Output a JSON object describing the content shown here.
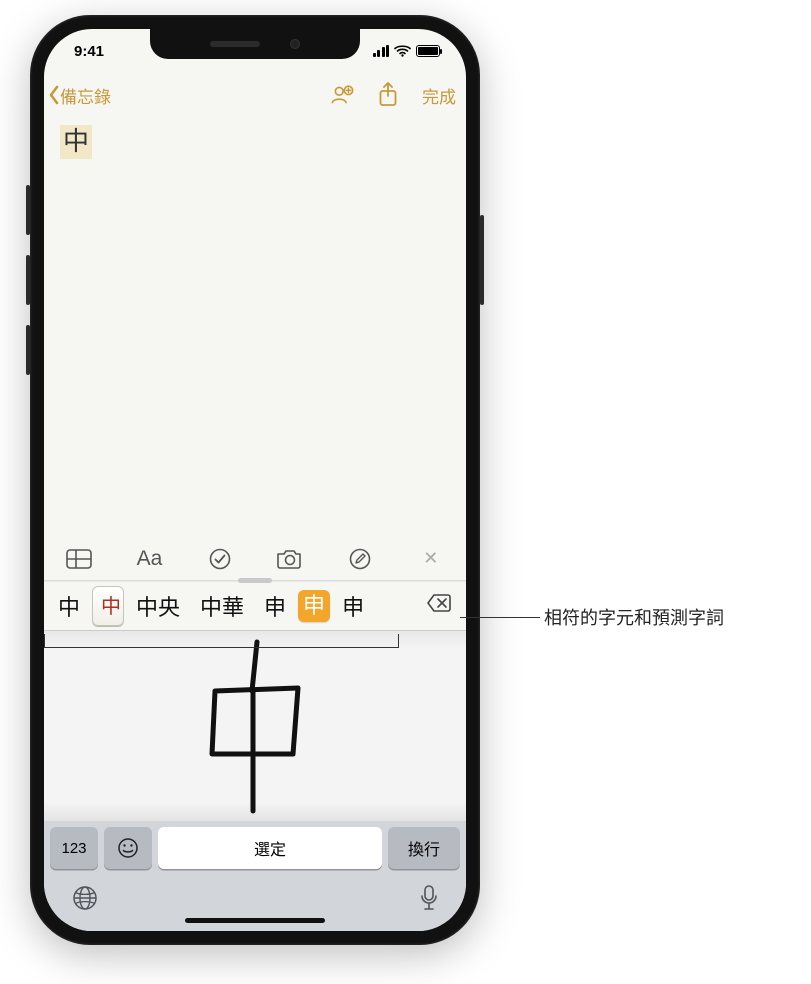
{
  "status": {
    "time": "9:41"
  },
  "nav": {
    "back_label": "備忘錄",
    "done_label": "完成"
  },
  "note": {
    "content": "中"
  },
  "candidates": {
    "c0": "中",
    "c1": "中",
    "c2": "中央",
    "c3": "中華",
    "c4": "申",
    "c5": "申",
    "c6": "申"
  },
  "keys": {
    "numeric": "123",
    "space": "選定",
    "return": "換行"
  },
  "annotation": {
    "label": "相符的字元和預測字詞"
  },
  "icons": {
    "add_people": "add-people-icon",
    "share": "share-icon",
    "table": "table-icon",
    "format": "format-icon",
    "checklist": "checklist-icon",
    "camera": "camera-icon",
    "draw": "draw-icon",
    "close": "close-icon",
    "delete": "delete-icon",
    "emoji": "emoji-icon",
    "globe": "globe-icon",
    "mic": "mic-icon"
  }
}
